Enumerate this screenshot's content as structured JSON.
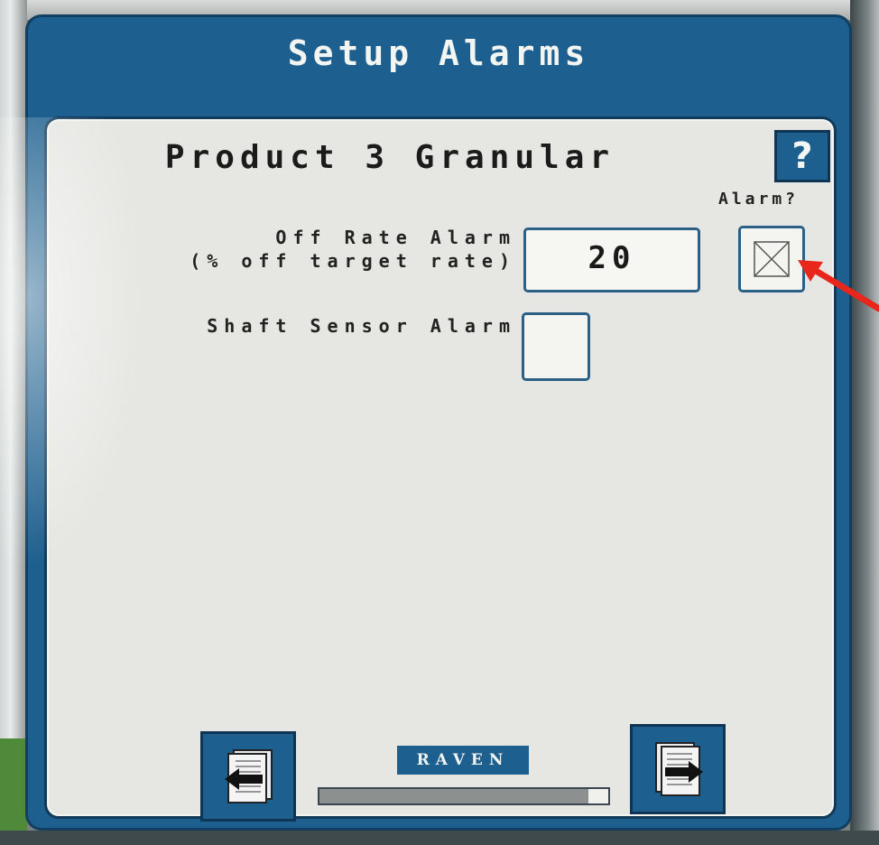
{
  "screen": {
    "title": "Setup Alarms"
  },
  "panel": {
    "title": "Product 3 Granular",
    "help_label": "?",
    "alarm_column_label": "Alarm?"
  },
  "off_rate": {
    "label_line1": "Off Rate Alarm",
    "label_line2": "(% off target rate)",
    "value": "20",
    "alarm_checked": true
  },
  "shaft_sensor": {
    "label": "Shaft Sensor Alarm",
    "checked": false
  },
  "footer": {
    "logo_text": "RAVEN",
    "progress": 0.93
  },
  "colors": {
    "frame_blue": "#1d5f8e",
    "panel_bg": "#e6e7e3",
    "annotation_red": "#e8261c"
  },
  "icons": [
    "help-icon",
    "checkbox-x-icon",
    "back-page-icon",
    "next-page-icon",
    "red-arrow-annotation"
  ]
}
